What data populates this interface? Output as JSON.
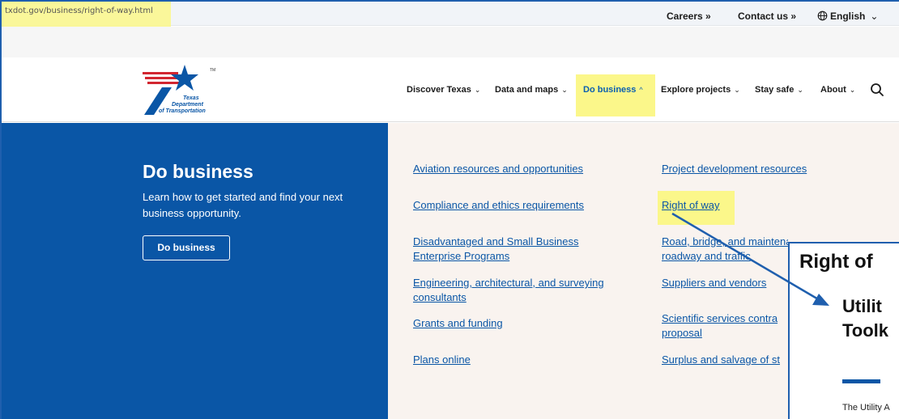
{
  "browser": {
    "url": "txdot.gov/business/right-of-way.html"
  },
  "utility": {
    "careers": "Careers »",
    "contact": "Contact us »",
    "language": "English"
  },
  "logo": {
    "line1": "Texas",
    "line2": "Department",
    "line3": "of Transportation",
    "tm": "TM"
  },
  "nav": {
    "items": [
      {
        "label": "Discover Texas"
      },
      {
        "label": "Data and maps"
      },
      {
        "label": "Do business"
      },
      {
        "label": "Explore projects"
      },
      {
        "label": "Stay safe"
      },
      {
        "label": "About"
      }
    ],
    "chev_down": "⌄",
    "chev_up": "^"
  },
  "panel": {
    "title": "Do business",
    "description": "Learn how to get started and find your next business opportunity.",
    "button": "Do business"
  },
  "menu": {
    "col1": [
      "Aviation resources and opportunities",
      "Compliance and ethics requirements",
      "Disadvantaged and Small Business Enterprise Programs",
      "Engineering, architectural, and surveying consultants",
      "Grants and funding",
      "Plans online"
    ],
    "col2": [
      "Project development resources",
      "Right of way",
      "Road, bridge, and maintenance contractors and roadway and traffic",
      "Suppliers and vendors",
      "Scientific services contra",
      "proposal",
      "Surplus and salvage of st"
    ]
  },
  "callout": {
    "title": "Right of",
    "sub1": "Utilit",
    "sub2": "Toolk",
    "body": "The Utility A"
  },
  "colors": {
    "brand_blue": "#0a56a6",
    "highlight": "#fbf78a",
    "arrow": "#1f5fae"
  }
}
